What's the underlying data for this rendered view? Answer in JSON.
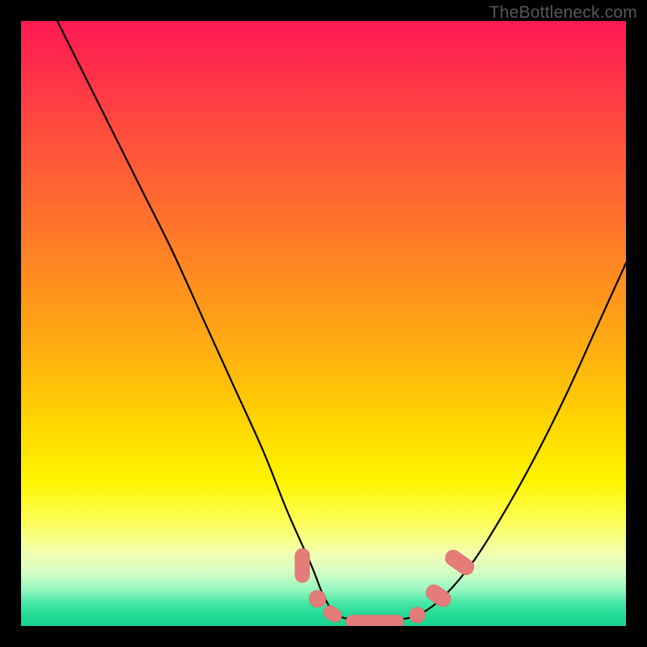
{
  "watermark": {
    "text": "TheBottleneck.com"
  },
  "colors": {
    "frame": "#000000",
    "curve_stroke": "#000000",
    "marker_fill": "#e47c7a",
    "marker_stroke": "#d86a69",
    "watermark": "#585858"
  },
  "chart_data": {
    "type": "line",
    "title": "",
    "xlabel": "",
    "ylabel": "",
    "xlim": [
      0,
      100
    ],
    "ylim": [
      0,
      100
    ],
    "grid": false,
    "legend": false,
    "series": [
      {
        "name": "bottleneck-curve",
        "x": [
          6,
          10,
          15,
          20,
          25,
          30,
          35,
          40,
          44,
          48,
          50,
          52,
          55,
          58,
          62,
          66,
          70,
          75,
          80,
          85,
          90,
          95,
          100
        ],
        "y": [
          100,
          92,
          82,
          72,
          62,
          51,
          40,
          29,
          19,
          10,
          5,
          2,
          1,
          1,
          1,
          2,
          5,
          11,
          19,
          28,
          38,
          49,
          60
        ]
      }
    ],
    "markers": [
      {
        "shape": "capsule",
        "orientation": "vertical",
        "x": 46.5,
        "y": 10.0,
        "rx": 1.2,
        "ry": 2.8
      },
      {
        "shape": "circle",
        "x": 49.0,
        "y": 4.5,
        "r": 1.4
      },
      {
        "shape": "capsule",
        "orientation": "diagonal-dn",
        "x": 51.5,
        "y": 2.0,
        "rx": 1.6,
        "ry": 1.1
      },
      {
        "shape": "capsule",
        "orientation": "horizontal",
        "x": 58.5,
        "y": 0.7,
        "rx": 4.8,
        "ry": 1.1
      },
      {
        "shape": "circle",
        "x": 65.5,
        "y": 1.8,
        "r": 1.3
      },
      {
        "shape": "capsule",
        "orientation": "diagonal-up",
        "x": 69.0,
        "y": 5.0,
        "rx": 1.3,
        "ry": 2.2
      },
      {
        "shape": "capsule",
        "orientation": "diagonal-up",
        "x": 72.5,
        "y": 10.5,
        "rx": 1.3,
        "ry": 2.6
      }
    ],
    "background": {
      "type": "vertical-gradient",
      "stops": [
        {
          "pos": 0.0,
          "color": "#ff1a52"
        },
        {
          "pos": 0.3,
          "color": "#ff6a30"
        },
        {
          "pos": 0.66,
          "color": "#ffd400"
        },
        {
          "pos": 0.83,
          "color": "#fcff5a"
        },
        {
          "pos": 0.94,
          "color": "#96f7c0"
        },
        {
          "pos": 1.0,
          "color": "#17d48e"
        }
      ]
    }
  }
}
